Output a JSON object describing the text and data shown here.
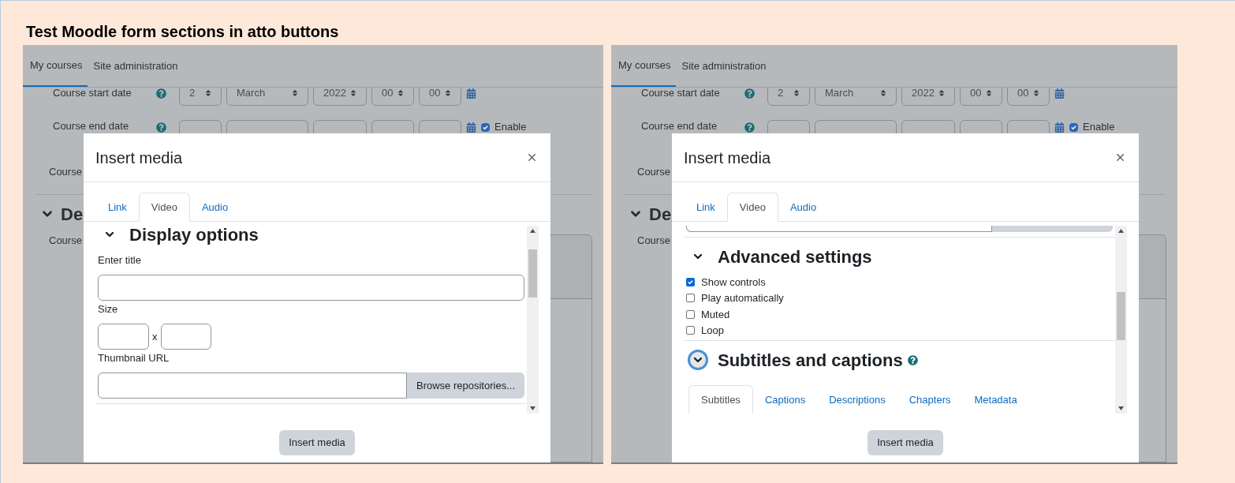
{
  "title": "Test Moodle form sections in atto buttons",
  "panels": [
    {
      "nav": [
        {
          "label": "My courses",
          "selected": true
        },
        {
          "label": "Site administration",
          "selected": false
        }
      ],
      "background": {
        "start_row": {
          "label": "Course start date",
          "values": [
            "2",
            "March",
            "2022",
            "00",
            "00"
          ]
        },
        "end_row": {
          "label": "Course end date",
          "enable": {
            "label": "Enable",
            "checked": true
          }
        },
        "third_label": "Course",
        "section_heading": "De",
        "section_label": "Course"
      },
      "modal": {
        "title": "Insert media",
        "tabs": [
          {
            "label": "Link",
            "selected": false
          },
          {
            "label": "Video",
            "selected": true
          },
          {
            "label": "Audio",
            "selected": false
          }
        ],
        "content": [
          {
            "kind": "heading",
            "text": "Display options",
            "focused": false,
            "help": false
          },
          {
            "kind": "label",
            "text": "Enter title"
          },
          {
            "kind": "field"
          },
          {
            "kind": "label",
            "text": "Size"
          },
          {
            "kind": "size",
            "separator": "x"
          },
          {
            "kind": "label",
            "text": "Thumbnail URL"
          },
          {
            "kind": "url",
            "button": "Browse repositories..."
          },
          {
            "kind": "divider"
          }
        ],
        "submit": "Insert media"
      }
    },
    {
      "nav": [
        {
          "label": "My courses",
          "selected": true
        },
        {
          "label": "Site administration",
          "selected": false
        }
      ],
      "background": {
        "start_row": {
          "label": "Course start date",
          "values": [
            "2",
            "March",
            "2022",
            "00",
            "00"
          ]
        },
        "end_row": {
          "label": "Course end date",
          "enable": {
            "label": "Enable",
            "checked": true
          }
        },
        "third_label": "Course",
        "section_heading": "De",
        "section_label": "Course"
      },
      "modal": {
        "title": "Insert media",
        "tabs": [
          {
            "label": "Link",
            "selected": false
          },
          {
            "label": "Video",
            "selected": true
          },
          {
            "label": "Audio",
            "selected": false
          }
        ],
        "content": [
          {
            "kind": "cut_url"
          },
          {
            "kind": "divider"
          },
          {
            "kind": "heading",
            "text": "Advanced settings",
            "focused": false,
            "help": false
          },
          {
            "kind": "checkbox",
            "label": "Show controls",
            "checked": true
          },
          {
            "kind": "checkbox",
            "label": "Play automatically",
            "checked": false
          },
          {
            "kind": "checkbox",
            "label": "Muted",
            "checked": false
          },
          {
            "kind": "checkbox",
            "label": "Loop",
            "checked": false
          },
          {
            "kind": "divider"
          },
          {
            "kind": "heading",
            "text": "Subtitles and captions",
            "focused": true,
            "help": true
          },
          {
            "kind": "tabs",
            "tabs": [
              {
                "label": "Subtitles",
                "selected": true
              },
              {
                "label": "Captions",
                "selected": false
              },
              {
                "label": "Descriptions",
                "selected": false
              },
              {
                "label": "Chapters",
                "selected": false
              },
              {
                "label": "Metadata",
                "selected": false
              }
            ]
          }
        ],
        "submit": "Insert media"
      }
    }
  ]
}
